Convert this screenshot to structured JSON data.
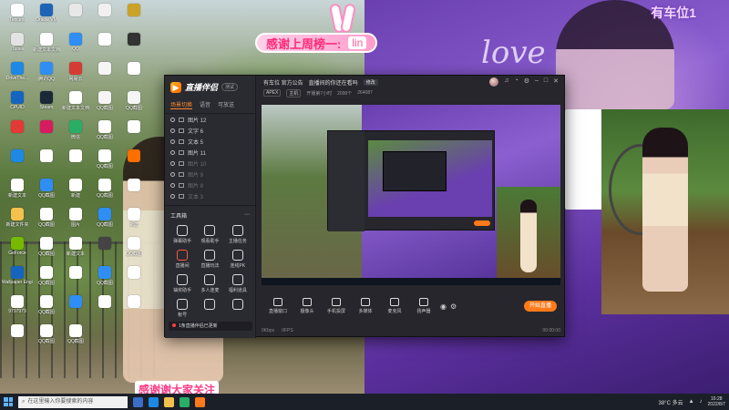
{
  "overlay": {
    "slot_label": "有车位1",
    "banner_text": "感谢上周榜一:",
    "banner_name": "lin",
    "love_text": "love",
    "bottom_banner": "感谢谢大家关注"
  },
  "desktop_icons": [
    {
      "label": "Tencent",
      "color": "#ffffff"
    },
    {
      "label": "Oracle VM",
      "color": "#1d64b6"
    },
    {
      "label": "",
      "color": "#e8e8e8"
    },
    {
      "label": "",
      "color": "#f0f0f0"
    },
    {
      "label": "",
      "color": "#c9a227"
    },
    {
      "label": "iTunes",
      "color": "#e3e3e3"
    },
    {
      "label": "新建文本文档",
      "color": "#ffffff"
    },
    {
      "label": "QQ",
      "color": "#2e8ef5"
    },
    {
      "label": "",
      "color": "#ffffff"
    },
    {
      "label": "",
      "color": "#333333"
    },
    {
      "label": "DriveThe...",
      "color": "#1e88e5"
    },
    {
      "label": "腾讯QQ",
      "color": "#2e8ef5"
    },
    {
      "label": "网易云",
      "color": "#d43c33"
    },
    {
      "label": "",
      "color": "#f5f5f5"
    },
    {
      "label": "",
      "color": "#ffffff"
    },
    {
      "label": "CPUID",
      "color": "#1565c0"
    },
    {
      "label": "Steam",
      "color": "#1b2838"
    },
    {
      "label": "新建文本文档",
      "color": "#ffffff"
    },
    {
      "label": "QQ截图",
      "color": "#f5f5f5"
    },
    {
      "label": "QQ截图",
      "color": "#f5f5f5"
    },
    {
      "label": "",
      "color": "#e53935"
    },
    {
      "label": "",
      "color": "#d81b60"
    },
    {
      "label": "微信",
      "color": "#2aae67"
    },
    {
      "label": "QQ截图",
      "color": "#ffffff"
    },
    {
      "label": "",
      "color": "#ffffff"
    },
    {
      "label": "",
      "color": "#1e88e5"
    },
    {
      "label": "",
      "color": "#ffffff"
    },
    {
      "label": "",
      "color": "#ffffff"
    },
    {
      "label": "QQ截图",
      "color": "#ffffff"
    },
    {
      "label": "",
      "color": "#ff6f00"
    },
    {
      "label": "新建文本",
      "color": "#ffffff"
    },
    {
      "label": "QQ截图",
      "color": "#2e8ef5"
    },
    {
      "label": "新建",
      "color": "#ffffff"
    },
    {
      "label": "QQ截图",
      "color": "#ffffff"
    },
    {
      "label": "",
      "color": "#ffffff"
    },
    {
      "label": "新建文件夹",
      "color": "#f2c14e"
    },
    {
      "label": "QQ截图",
      "color": "#ffffff"
    },
    {
      "label": "图片",
      "color": "#ffffff"
    },
    {
      "label": "QQ截图",
      "color": "#2e8ef5"
    },
    {
      "label": "新建",
      "color": "#ffffff"
    },
    {
      "label": "GeForce",
      "color": "#76b900"
    },
    {
      "label": "QQ截图",
      "color": "#ffffff"
    },
    {
      "label": "新建文本",
      "color": "#ffffff"
    },
    {
      "label": "",
      "color": "#444444"
    },
    {
      "label": "QQ截图",
      "color": "#ffffff"
    },
    {
      "label": "Wallpaper Engine",
      "color": "#1565c0"
    },
    {
      "label": "QQ截图",
      "color": "#ffffff"
    },
    {
      "label": "",
      "color": "#ffffff"
    },
    {
      "label": "QQ截图",
      "color": "#2e8ef5"
    },
    {
      "label": "",
      "color": "#ffffff"
    },
    {
      "label": "9797979",
      "color": "#ffffff"
    },
    {
      "label": "QQ截图",
      "color": "#ffffff"
    },
    {
      "label": "",
      "color": "#2e8ef5"
    },
    {
      "label": "",
      "color": "#ffffff"
    },
    {
      "label": "",
      "color": "#ffffff"
    },
    {
      "label": "",
      "color": "#ffffff"
    },
    {
      "label": "QQ截图",
      "color": "#ffffff"
    },
    {
      "label": "QQ截图",
      "color": "#ffffff"
    }
  ],
  "app": {
    "logo_text": "直播伴侣",
    "version_badge": "测试",
    "scene_tabs": [
      "场景切换",
      "语音",
      "可放送"
    ],
    "sources": [
      {
        "label": "图片 12",
        "active": true
      },
      {
        "label": "文字 6",
        "active": true
      },
      {
        "label": "文本 5",
        "active": true
      },
      {
        "label": "图片 11",
        "active": true
      },
      {
        "label": "图片 10",
        "active": false
      },
      {
        "label": "图片 9",
        "active": false
      },
      {
        "label": "图片 8",
        "active": false
      },
      {
        "label": "文本 3",
        "active": false
      }
    ],
    "tools_title": "工具箱",
    "tools": [
      {
        "label": "弹幕助手",
        "icon": "chat-icon",
        "hot": false
      },
      {
        "label": "观看助手",
        "icon": "person-icon",
        "hot": false
      },
      {
        "label": "主播任务",
        "icon": "task-icon",
        "hot": false
      },
      {
        "label": "直播间",
        "icon": "live-room-icon",
        "hot": true
      },
      {
        "label": "直播玩法",
        "icon": "game-icon",
        "hot": false
      },
      {
        "label": "连线PK",
        "icon": "pk-icon",
        "hot": false
      },
      {
        "label": "抽奖助手",
        "icon": "gift-icon",
        "hot": false
      },
      {
        "label": "多人连麦",
        "icon": "mic-group-icon",
        "hot": false
      },
      {
        "label": "福利道具",
        "icon": "bag-icon",
        "hot": false
      },
      {
        "label": "帐号",
        "icon": "user-icon",
        "hot": false
      },
      {
        "label": "",
        "icon": "download-icon",
        "hot": false
      },
      {
        "label": "",
        "icon": "upload-icon",
        "hot": false
      }
    ],
    "notice_text": "1条直播伴侣已更新",
    "stream_title": "有车位 官方公告",
    "stream_subtitle": "直播间的你还在看吗",
    "edit_label": "修改",
    "meta": {
      "tag": "APEX",
      "category": "主机",
      "viewers": "开播第7小时",
      "count1": "2000个",
      "count2": "264087"
    },
    "controls": [
      {
        "label": "直播窗口",
        "icon": "screen-icon"
      },
      {
        "label": "摄像头",
        "icon": "camera-icon"
      },
      {
        "label": "手机投屏",
        "icon": "phone-icon"
      },
      {
        "label": "多媒体",
        "icon": "media-icon"
      },
      {
        "label": "麦克风",
        "icon": "mic-icon"
      },
      {
        "label": "扬声器",
        "icon": "speaker-icon"
      }
    ],
    "go_live_label": "开始直播",
    "status": {
      "left": "0Kbps",
      "mid": "0FPS",
      "time": "00:00:00"
    }
  },
  "taskbar": {
    "search_placeholder": "在这里输入你要搜索的内容",
    "weather": "38°C 多云",
    "time": "16:28",
    "date": "2022/8/7"
  },
  "colors": {
    "accent": "#ff7a1a",
    "banner_pink": "#ff3b88",
    "purple": "#6a3fb0"
  }
}
